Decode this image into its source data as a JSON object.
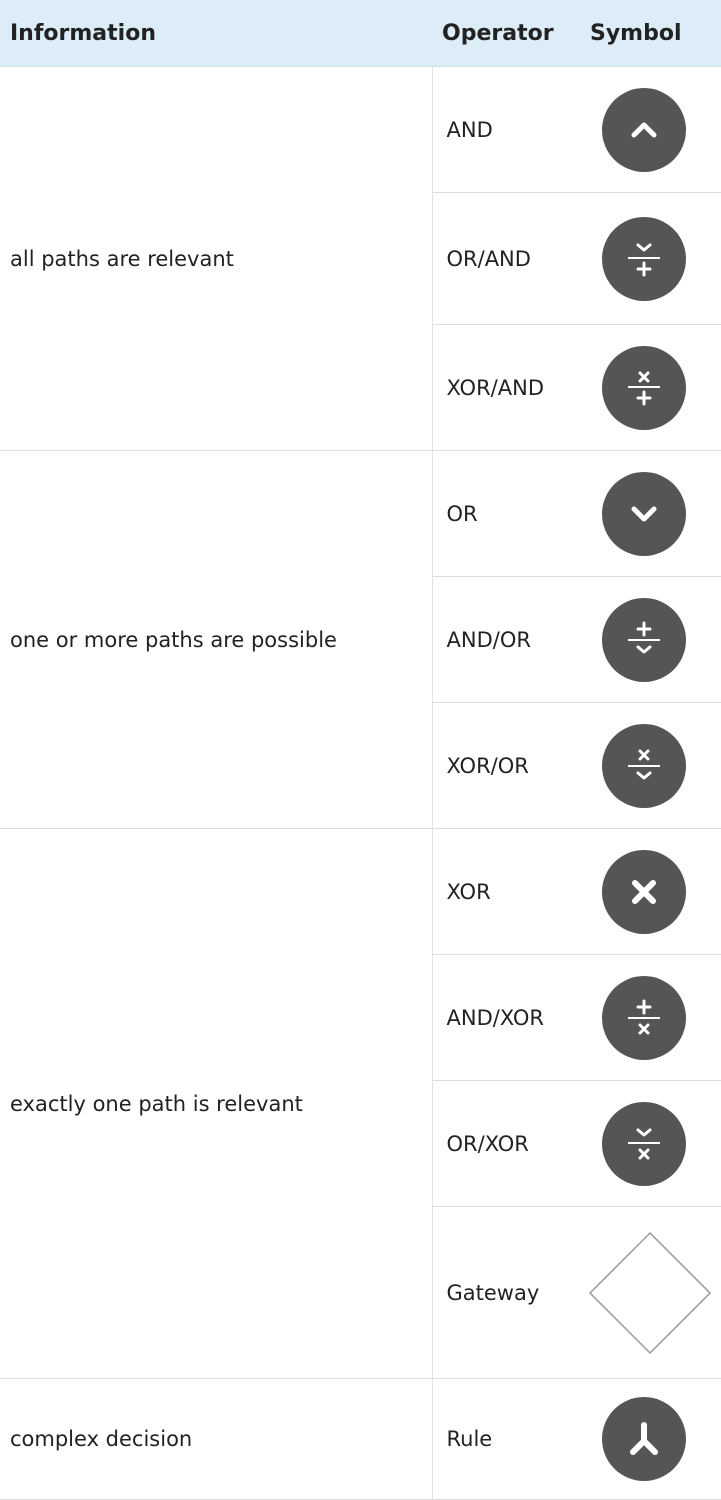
{
  "headers": {
    "information": "Information",
    "operator": "Operator",
    "symbol": "Symbol"
  },
  "groups": [
    {
      "information": "all paths are relevant",
      "rows": [
        {
          "operator": "AND",
          "icon": "and-gateway-icon"
        },
        {
          "operator": "OR/AND",
          "icon": "or-and-gateway-icon"
        },
        {
          "operator": "XOR/AND",
          "icon": "xor-and-gateway-icon"
        }
      ]
    },
    {
      "information": "one or more paths are possible",
      "rows": [
        {
          "operator": "OR",
          "icon": "or-gateway-icon"
        },
        {
          "operator": "AND/OR",
          "icon": "and-or-gateway-icon"
        },
        {
          "operator": "XOR/OR",
          "icon": "xor-or-gateway-icon"
        }
      ]
    },
    {
      "information": "exactly one path is relevant",
      "rows": [
        {
          "operator": "XOR",
          "icon": "xor-gateway-icon"
        },
        {
          "operator": "AND/XOR",
          "icon": "and-xor-gateway-icon"
        },
        {
          "operator": "OR/XOR",
          "icon": "or-xor-gateway-icon"
        },
        {
          "operator": "Gateway",
          "icon": "gateway-diamond-icon"
        }
      ]
    },
    {
      "information": "complex decision",
      "rows": [
        {
          "operator": "Rule",
          "icon": "rule-gateway-icon"
        }
      ]
    }
  ],
  "colors": {
    "header_bg": "#dcedf7",
    "icon_fill": "#555555",
    "icon_glyph": "#ffffff"
  }
}
